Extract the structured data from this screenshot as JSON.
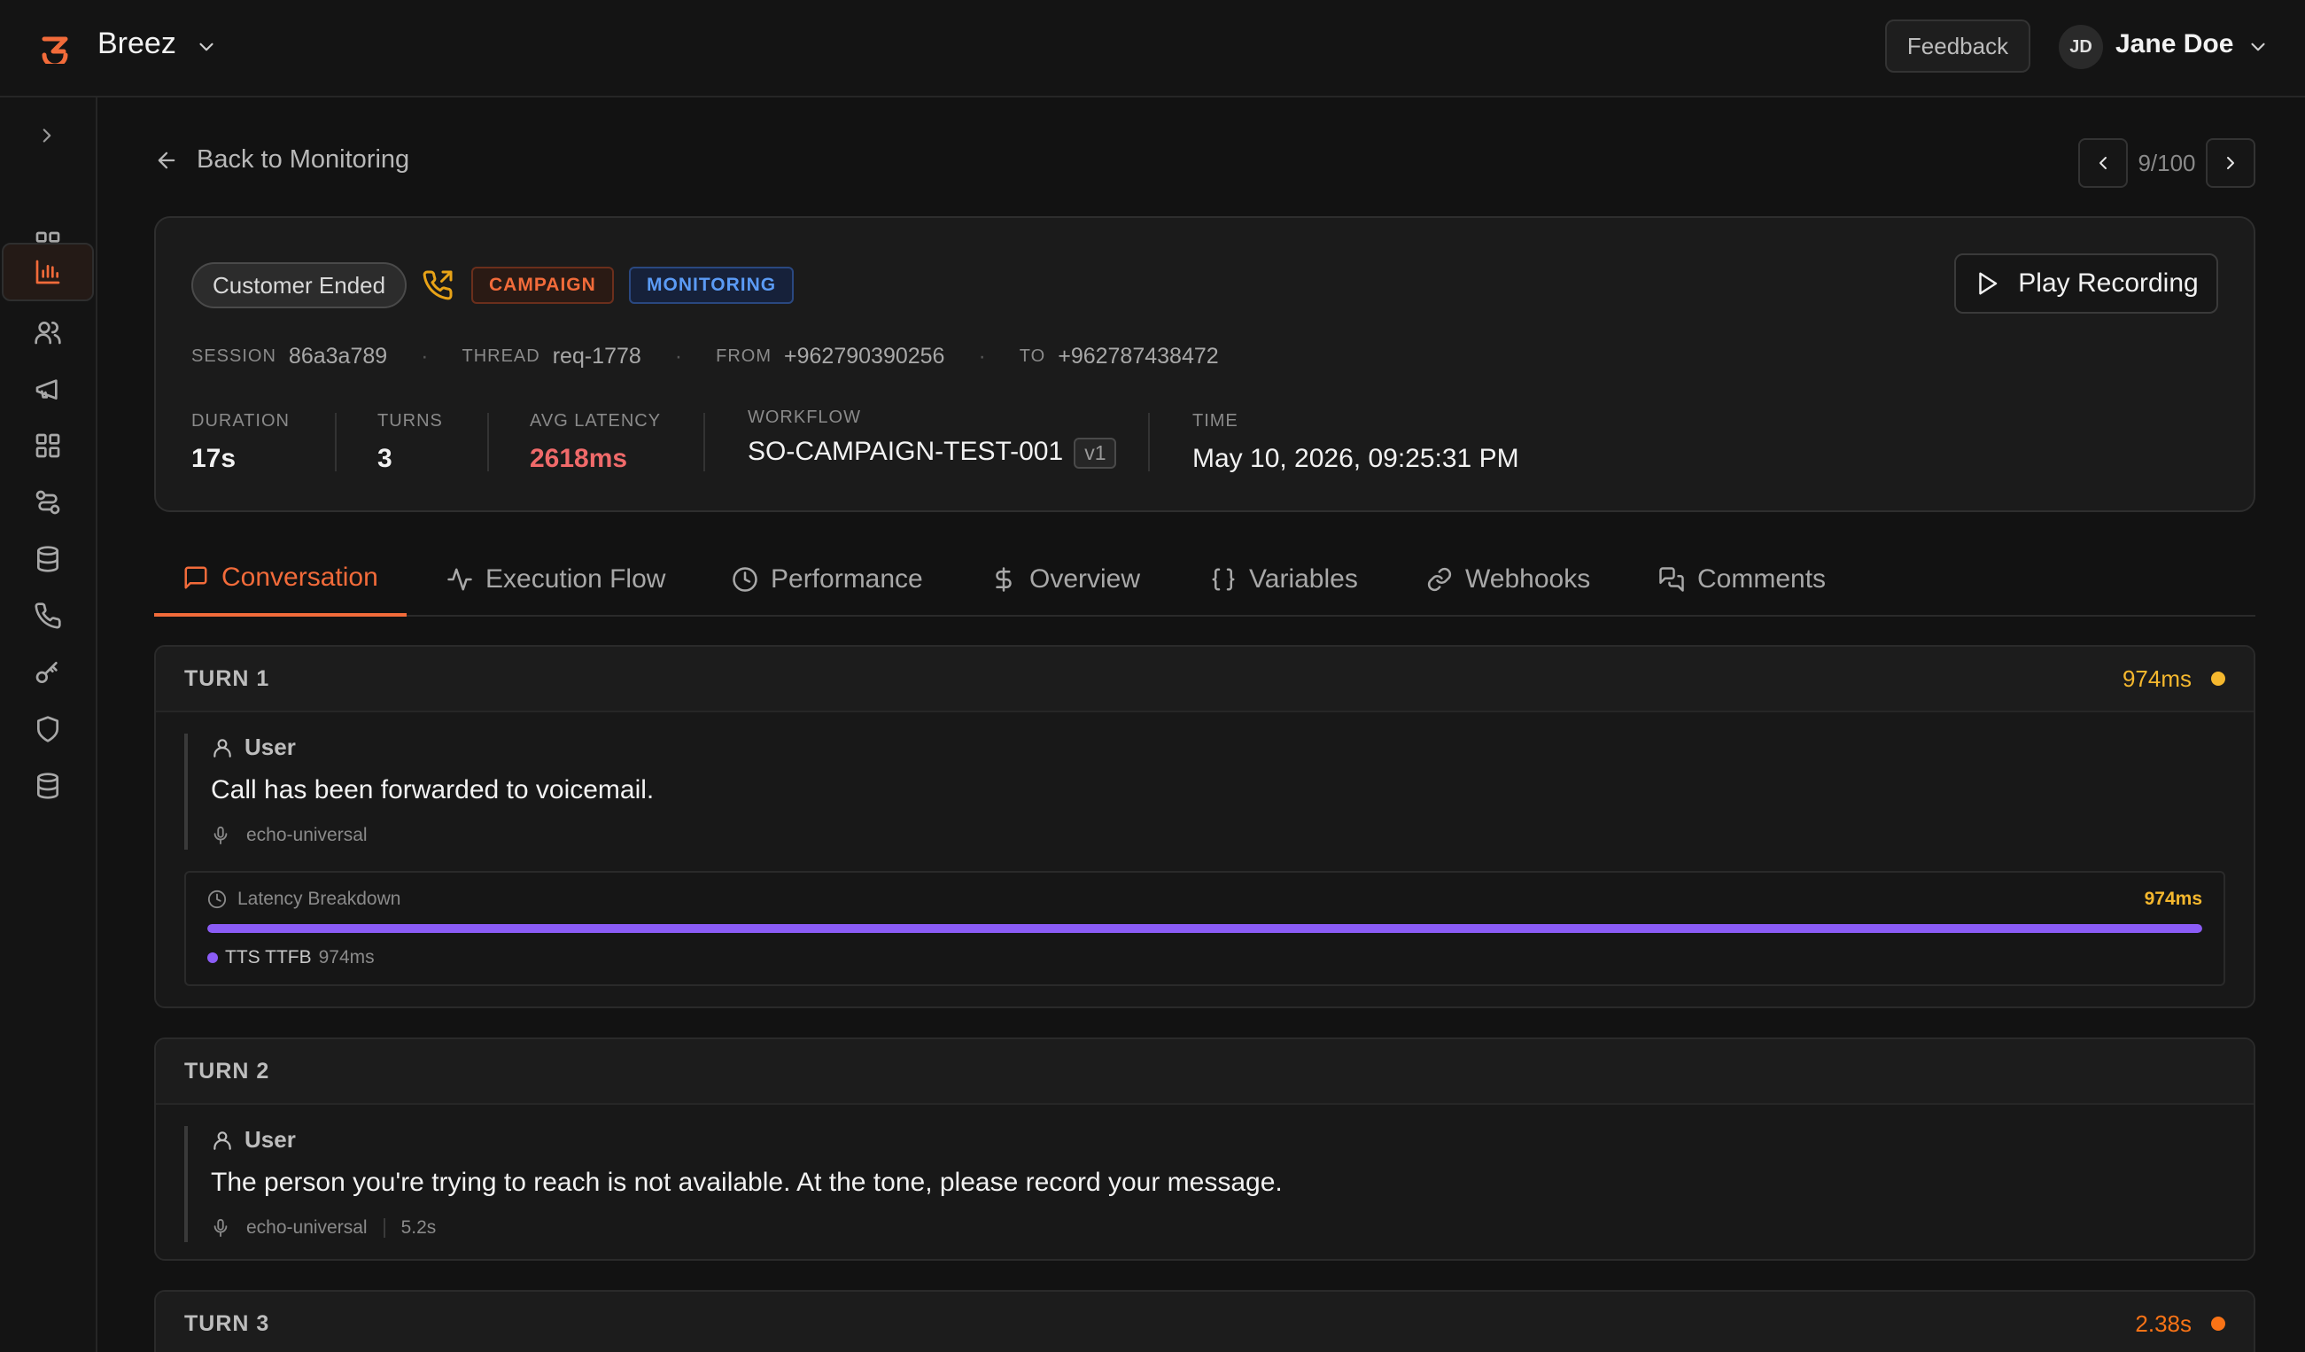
{
  "app": {
    "name": "Breez"
  },
  "header": {
    "feedback_label": "Feedback",
    "user": {
      "initials": "JD",
      "name": "Jane Doe"
    }
  },
  "sidebar": {
    "items": [
      {
        "icon": "dashboard-icon"
      },
      {
        "icon": "analytics-icon",
        "active": true
      },
      {
        "icon": "users-icon"
      },
      {
        "icon": "megaphone-icon"
      },
      {
        "icon": "apps-icon"
      },
      {
        "icon": "workflow-icon"
      },
      {
        "icon": "database-icon"
      },
      {
        "icon": "phone-icon"
      },
      {
        "icon": "key-icon"
      },
      {
        "icon": "shield-icon"
      },
      {
        "icon": "storage-icon"
      }
    ]
  },
  "nav": {
    "back_label": "Back to Monitoring",
    "pager": "9/100"
  },
  "session": {
    "status": "Customer Ended",
    "tags": [
      "CAMPAIGN",
      "MONITORING"
    ],
    "play_label": "Play Recording",
    "ids": {
      "session_key": "SESSION",
      "session": "86a3a789",
      "thread_key": "THREAD",
      "thread": "req-1778",
      "from_key": "FROM",
      "from": "+962790390256",
      "to_key": "TO",
      "to": "+962787438472"
    },
    "stats": {
      "duration_key": "DURATION",
      "duration": "17s",
      "turns_key": "TURNS",
      "turns": "3",
      "latency_key": "AVG LATENCY",
      "latency": "2618ms",
      "workflow_key": "WORKFLOW",
      "workflow": "SO-CAMPAIGN-TEST-001",
      "workflow_version": "v1",
      "time_key": "TIME",
      "time": "May 10, 2026, 09:25:31 PM"
    }
  },
  "tabs": [
    {
      "label": "Conversation",
      "icon": "message-icon",
      "active": true
    },
    {
      "label": "Execution Flow",
      "icon": "activity-icon"
    },
    {
      "label": "Performance",
      "icon": "clock-icon"
    },
    {
      "label": "Overview",
      "icon": "dollar-icon"
    },
    {
      "label": "Variables",
      "icon": "braces-icon"
    },
    {
      "label": "Webhooks",
      "icon": "link-icon"
    },
    {
      "label": "Comments",
      "icon": "comments-icon"
    }
  ],
  "turns": [
    {
      "title": "TURN 1",
      "latency": "974ms",
      "latency_color": "#f5b82e",
      "message": {
        "role": "User",
        "text": "Call has been forwarded to voicemail.",
        "engine": "echo-universal"
      },
      "latency_breakdown": {
        "title": "Latency Breakdown",
        "total": "974ms",
        "bar_fill_fraction": 1.0,
        "items": [
          {
            "name": "TTS TTFB",
            "value": "974ms",
            "color": "#8b5cf6"
          }
        ]
      }
    },
    {
      "title": "TURN 2",
      "message": {
        "role": "User",
        "text": "The person you're trying to reach is not available. At the tone, please record your message.",
        "engine": "echo-universal",
        "duration": "5.2s"
      }
    },
    {
      "title": "TURN 3",
      "latency": "2.38s",
      "latency_color": "#f97316"
    }
  ],
  "colors": {
    "accent": "#f26b3a",
    "latency_red": "#f06a6a",
    "campaign": "#f26b3a",
    "monitoring": "#5b9bf5"
  }
}
